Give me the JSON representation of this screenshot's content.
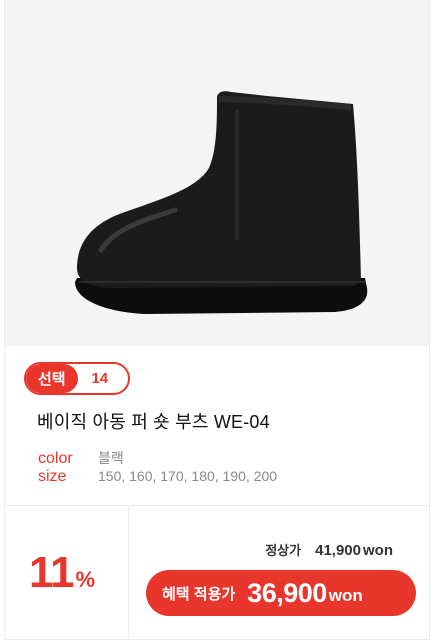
{
  "product": {
    "badge_label": "선택",
    "badge_count": "14",
    "title": "베이직 아동 퍼 숏 부츠 WE-04",
    "specs": {
      "color_label": "color",
      "color_value": "블랙",
      "size_label": "size",
      "size_value": "150, 160, 170, 180, 190, 200"
    },
    "image_icon": "black-ankle-boot"
  },
  "pricing": {
    "discount_number": "11",
    "discount_unit": "%",
    "original_label": "정상가",
    "original_amount": "41,900",
    "original_unit": "won",
    "sale_label": "혜택 적용가",
    "sale_amount": "36,900",
    "sale_unit": "won"
  },
  "colors": {
    "accent": "#e8362d",
    "photo_bg": "#f4f4f4"
  }
}
